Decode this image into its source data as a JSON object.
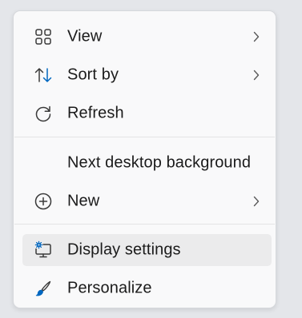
{
  "context_menu": {
    "items": [
      {
        "label": "View",
        "icon": "grid-icon",
        "has_submenu": true
      },
      {
        "label": "Sort by",
        "icon": "sort-arrows-icon",
        "has_submenu": true
      },
      {
        "label": "Refresh",
        "icon": "refresh-icon",
        "has_submenu": false
      },
      {
        "label": "Next desktop background",
        "icon": "",
        "has_submenu": false
      },
      {
        "label": "New",
        "icon": "plus-circle-icon",
        "has_submenu": true
      },
      {
        "label": "Display settings",
        "icon": "display-settings-icon",
        "has_submenu": false,
        "highlighted": true
      },
      {
        "label": "Personalize",
        "icon": "paintbrush-icon",
        "has_submenu": false
      }
    ]
  },
  "colors": {
    "accent": "#0067c0",
    "text": "#1b1b1b",
    "menu_background": "#f9f9fa",
    "hover_background": "#ebebec"
  }
}
